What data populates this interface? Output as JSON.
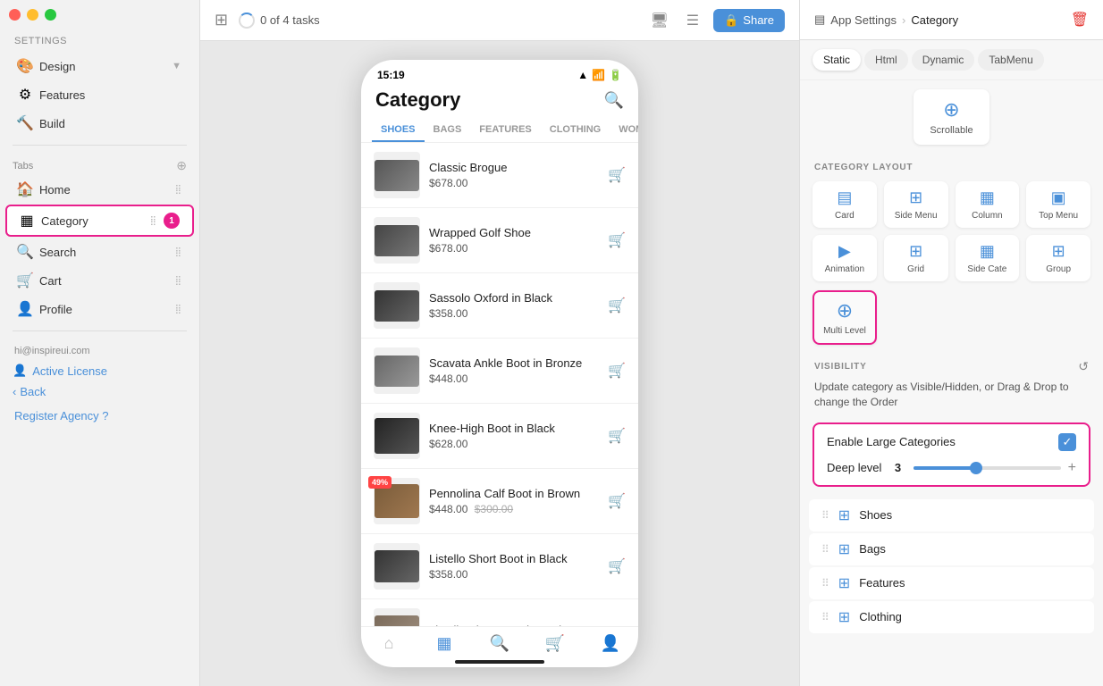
{
  "trafficLights": [
    "red",
    "yellow",
    "green"
  ],
  "sidebar": {
    "settingsLabel": "Settings",
    "designLabel": "Design",
    "featuresLabel": "Features",
    "buildLabel": "Build",
    "tabsLabel": "Tabs",
    "items": [
      {
        "id": "home",
        "label": "Home",
        "icon": "🏠",
        "active": false
      },
      {
        "id": "category",
        "label": "Category",
        "icon": "▦",
        "active": true,
        "badge": "1"
      },
      {
        "id": "search",
        "label": "Search",
        "icon": "⊙",
        "active": false
      },
      {
        "id": "cart",
        "label": "Cart",
        "icon": "🛒",
        "active": false
      },
      {
        "id": "profile",
        "label": "Profile",
        "icon": "👤",
        "active": false
      }
    ],
    "userEmail": "hi@inspireui.com",
    "activeLicenseLabel": "Active License",
    "backLabel": "Back",
    "registerLabel": "Register Agency",
    "registerHelper": "?"
  },
  "topBar": {
    "tasksLabel": "0 of 4 tasks",
    "shareLabel": "Share"
  },
  "phone": {
    "time": "15:19",
    "title": "Category",
    "tabs": [
      "SHOES",
      "BAGS",
      "FEATURES",
      "CLOTHING",
      "WOMEN"
    ],
    "activeTab": "SHOES",
    "products": [
      {
        "name": "Classic Brogue",
        "price": "$678.00",
        "oldPrice": ""
      },
      {
        "name": "Wrapped Golf Shoe",
        "price": "$678.00",
        "oldPrice": ""
      },
      {
        "name": "Sassolo Oxford in Black",
        "price": "$358.00",
        "oldPrice": ""
      },
      {
        "name": "Scavata Ankle Boot in Bronze",
        "price": "$448.00",
        "oldPrice": ""
      },
      {
        "name": "Knee-High Boot in Black",
        "price": "$628.00",
        "oldPrice": ""
      },
      {
        "name": "Pennolina Calf Boot in Brown",
        "price": "$448.00",
        "oldPrice": "$300.00",
        "discount": "49%"
      },
      {
        "name": "Listello Short Boot in Black",
        "price": "$358.00",
        "oldPrice": ""
      },
      {
        "name": "Listello Short Boot in Mud",
        "price": "",
        "oldPrice": ""
      }
    ],
    "bottomNav": [
      "home",
      "grid",
      "search",
      "cart",
      "profile"
    ]
  },
  "rightPanel": {
    "breadcrumb": [
      "App Settings",
      "Category"
    ],
    "layoutTabs": [
      "Static",
      "Html",
      "Dynamic",
      "TabMenu"
    ],
    "activeLayoutTab": "Static",
    "scrollableLabel": "Scrollable",
    "categoryLayoutTitle": "CATEGORY LAYOUT",
    "layoutOptions": [
      {
        "id": "card",
        "label": "Card",
        "icon": "▤",
        "selected": false
      },
      {
        "id": "side-menu",
        "label": "Side Menu",
        "icon": "⊞",
        "selected": false
      },
      {
        "id": "column",
        "label": "Column",
        "icon": "▦",
        "selected": false
      },
      {
        "id": "top-menu",
        "label": "Top Menu",
        "icon": "▣",
        "selected": false
      },
      {
        "id": "animation",
        "label": "Animation",
        "icon": "▶",
        "selected": false
      },
      {
        "id": "grid",
        "label": "Grid",
        "icon": "⊞",
        "selected": false
      },
      {
        "id": "side-cate",
        "label": "Side Cate",
        "icon": "▦",
        "selected": false
      },
      {
        "id": "group",
        "label": "Group",
        "icon": "⊞",
        "selected": false
      },
      {
        "id": "multi-level",
        "label": "Multi Level",
        "icon": "⊕",
        "selected": true,
        "highlight": true
      }
    ],
    "visibilityTitle": "VISIBILITY",
    "visibilityDesc": "Update category as Visible/Hidden, or Drag & Drop to change the Order",
    "enableLargeLabel": "Enable Large Categories",
    "enableLargeChecked": true,
    "deepLevelLabel": "Deep level",
    "deepLevelValue": "3",
    "categories": [
      "Shoes",
      "Bags",
      "Features",
      "Clothing"
    ]
  }
}
